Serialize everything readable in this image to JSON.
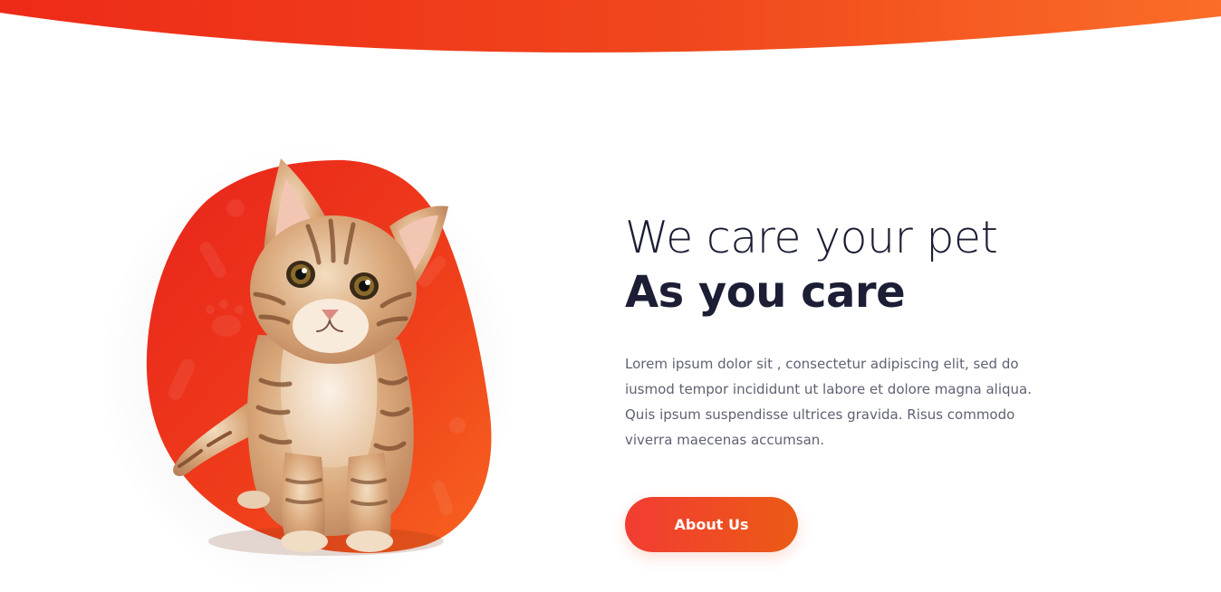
{
  "hero": {
    "headline_light": "We care your pet",
    "headline_bold": "As you care",
    "description": "Lorem ipsum dolor sit , consectetur adipiscing elit, sed do iusmod tempor incididunt ut labore et dolore magna aliqua. Quis ipsum suspendisse ultrices gravida. Risus commodo viverra maecenas accumsan.",
    "cta_label": "About Us",
    "image_subject": "kitten-on-orange-blob"
  },
  "colors": {
    "accent_start": "#ee2d1c",
    "accent_end": "#fb6b26",
    "headline": "#1b1e34",
    "body_text": "#5f6272",
    "button_text": "#ffffff"
  }
}
